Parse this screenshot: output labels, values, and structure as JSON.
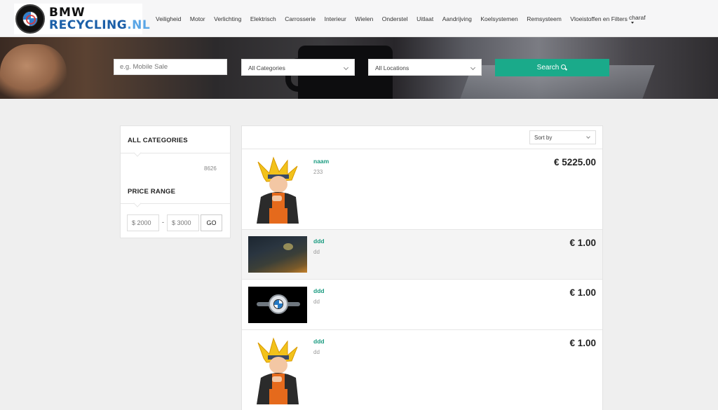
{
  "header": {
    "logo": {
      "line1": "BMW",
      "line2a": "RECYCLING",
      "line2b": ".NL",
      "roundel_letters": "B M W"
    },
    "nav": [
      "Veiligheid",
      "Motor",
      "Verlichting",
      "Elektrisch",
      "Carrosserie",
      "Interieur",
      "Wielen",
      "Onderstel",
      "Uitlaat",
      "Aandrijving",
      "Koelsystemen",
      "Remsysteem",
      "Vloeistoffen en Filters"
    ],
    "user": "charaf"
  },
  "search": {
    "placeholder": "e.g. Mobile Sale",
    "category_selected": "All Categories",
    "location_selected": "All Locations",
    "button_label": "Search",
    "button_color": "#1aaa8a"
  },
  "sidebar": {
    "categories_heading": "ALL CATEGORIES",
    "category_count": "8626",
    "price_heading": "PRICE RANGE",
    "price_min_placeholder": "$ 2000",
    "price_max_placeholder": "$ 3000",
    "separator": "-",
    "go_label": "GO"
  },
  "listing": {
    "sort_label": "Sort by",
    "items": [
      {
        "title": "naam",
        "subtitle": "233",
        "price": "€ 5225.00",
        "image": "ninja-character-image"
      },
      {
        "title": "ddd",
        "subtitle": "dd",
        "price": "€ 1.00",
        "image": "space-sky-image"
      },
      {
        "title": "ddd",
        "subtitle": "dd",
        "price": "€ 1.00",
        "image": "bmw-logo-image"
      },
      {
        "title": "ddd",
        "subtitle": "dd",
        "price": "€ 1.00",
        "image": "ninja-character-image"
      }
    ]
  },
  "colors": {
    "accent": "#1aaa8a",
    "title_link": "#1a9b80",
    "background": "#efefef"
  }
}
